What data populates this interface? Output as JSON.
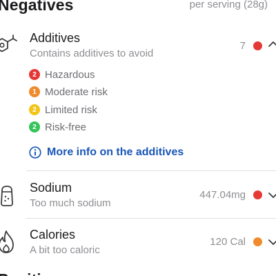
{
  "header": {
    "title": "Negatives",
    "serving_label": "per serving (28g)"
  },
  "additives": {
    "title": "Additives",
    "subtitle": "Contains additives to avoid",
    "value": "7",
    "dot_color": "#e53935",
    "legend": [
      {
        "badge": "2",
        "label": "Hazardous",
        "color": "#e53935"
      },
      {
        "badge": "1",
        "label": "Moderate risk",
        "color": "#ef8b2c"
      },
      {
        "badge": "2",
        "label": "Limited risk",
        "color": "#f2c418"
      },
      {
        "badge": "2",
        "label": "Risk-free",
        "color": "#34c45a"
      }
    ],
    "more_info_label": "More info on the additives",
    "link_color": "#1a56b8"
  },
  "sodium": {
    "title": "Sodium",
    "subtitle": "Too much sodium",
    "value": "447.04mg",
    "dot_color": "#e53935"
  },
  "calories": {
    "title": "Calories",
    "subtitle": "A bit too caloric",
    "value": "120 Cal",
    "dot_color": "#ef8b2c"
  },
  "next_section": {
    "title": "Positives"
  }
}
